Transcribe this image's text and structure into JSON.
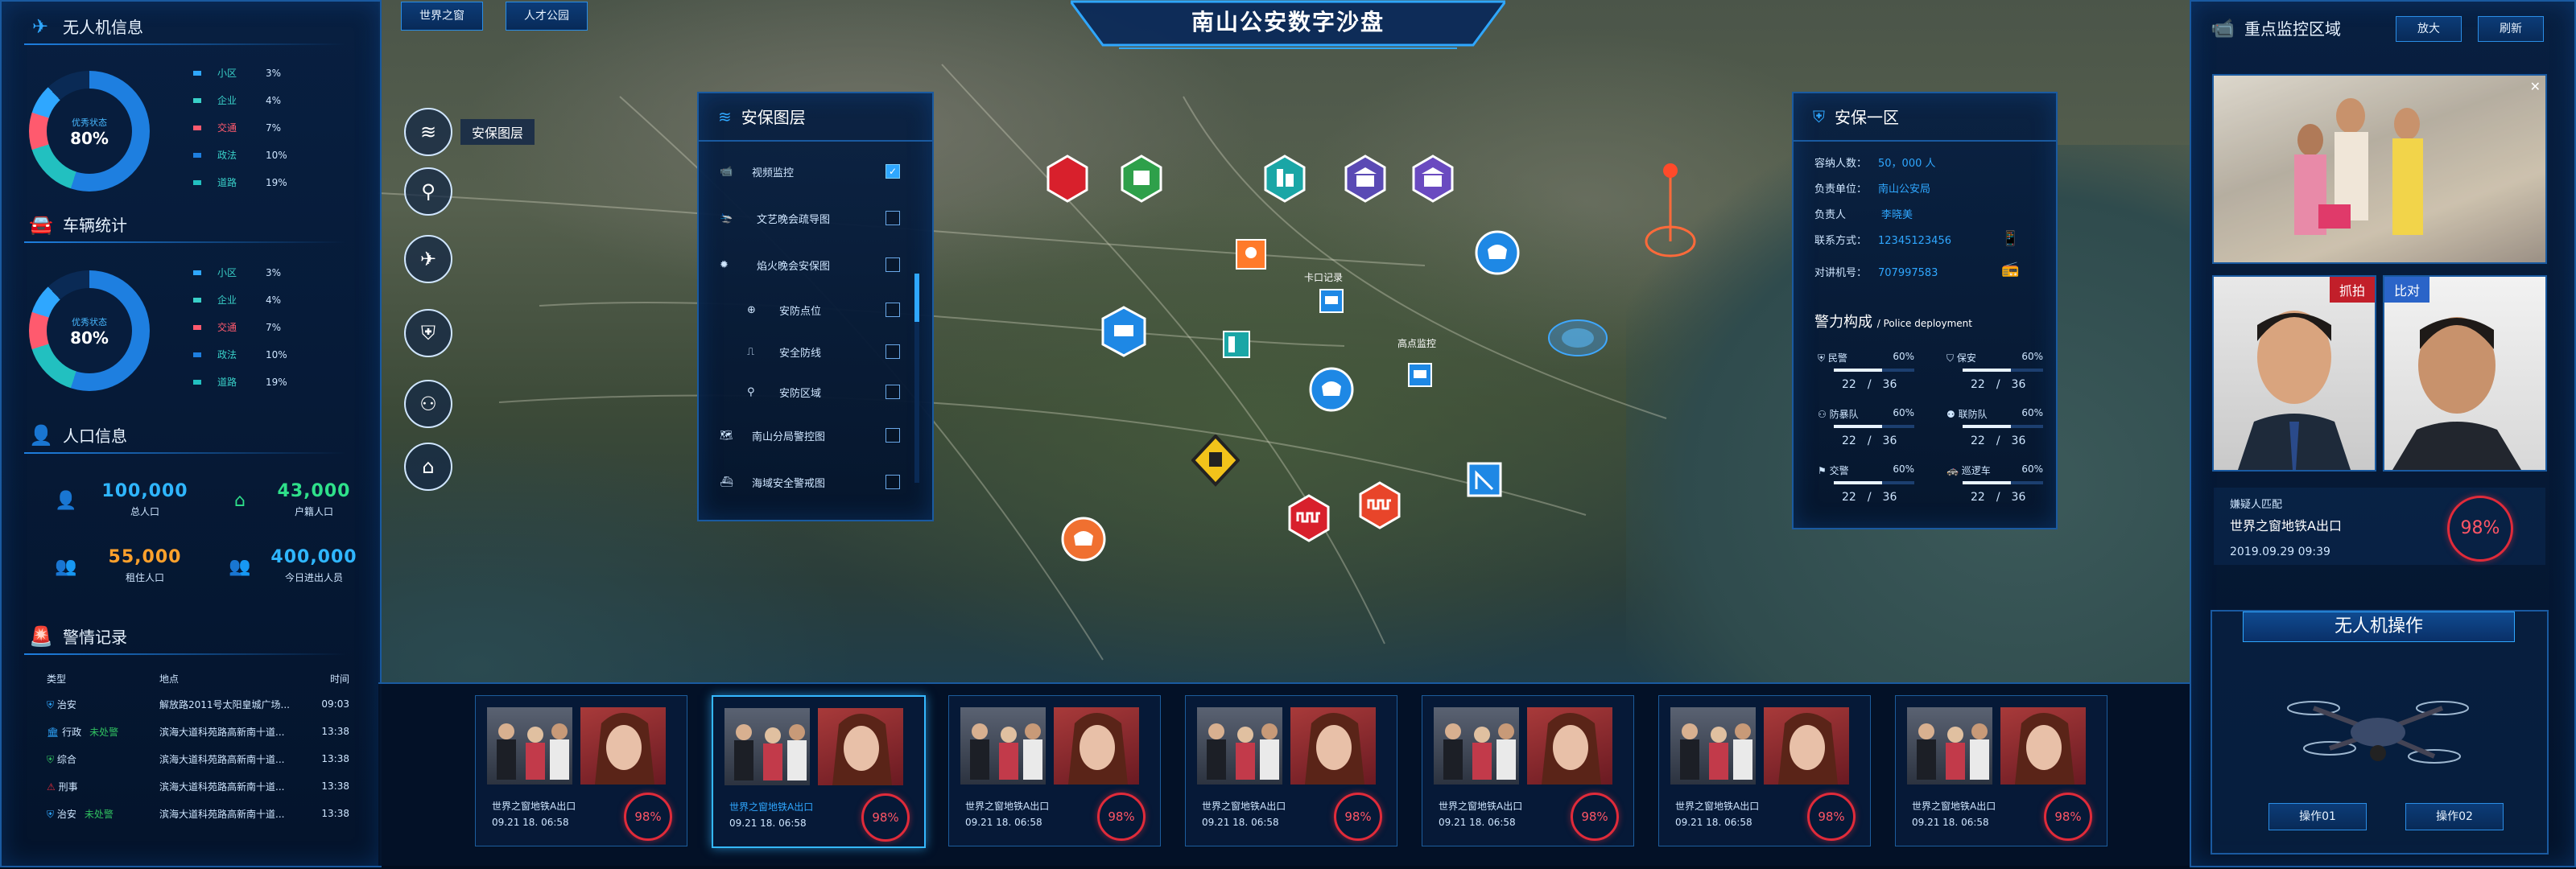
{
  "title": "南山公安数字沙盘",
  "top_tabs": [
    "世界之窗",
    "人才公园"
  ],
  "drone": {
    "title": "无人机信息",
    "status": "优秀状态",
    "percent": "80%",
    "legend": [
      {
        "label": "小区",
        "pct": "3%",
        "color": "#2fa7ff"
      },
      {
        "label": "企业",
        "pct": "4%",
        "color": "#39d0c8"
      },
      {
        "label": "交通",
        "pct": "7%",
        "color": "#ff5a6e"
      },
      {
        "label": "政法",
        "pct": "10%",
        "color": "#1e7fe0"
      },
      {
        "label": "道路",
        "pct": "19%",
        "color": "#22c0c0"
      }
    ]
  },
  "vehicle": {
    "title": "车辆统计",
    "status": "优秀状态",
    "percent": "80%",
    "legend": [
      {
        "label": "小区",
        "pct": "3%",
        "color": "#2fa7ff"
      },
      {
        "label": "企业",
        "pct": "4%",
        "color": "#39d0c8"
      },
      {
        "label": "交通",
        "pct": "7%",
        "color": "#ff5a6e"
      },
      {
        "label": "政法",
        "pct": "10%",
        "color": "#1e7fe0"
      },
      {
        "label": "道路",
        "pct": "19%",
        "color": "#22c0c0"
      }
    ]
  },
  "population": {
    "title": "人口信息",
    "items": [
      {
        "num": "100,000",
        "cap": "总人口",
        "color": "#2fb6ff"
      },
      {
        "num": "43,000",
        "cap": "户籍人口",
        "color": "#2fe08a"
      },
      {
        "num": "55,000",
        "cap": "租住人口",
        "color": "#ffa12c"
      },
      {
        "num": "400,000",
        "cap": "今日进出人员",
        "color": "#2fb6ff"
      }
    ]
  },
  "alarms": {
    "title": "警情记录",
    "headers": [
      "类型",
      "地点",
      "时间"
    ],
    "rows": [
      {
        "type": "治安",
        "status": "",
        "place": "解放路2011号太阳皇城广场...",
        "time": "09:03",
        "color": "#2fa7ff"
      },
      {
        "type": "行政",
        "status": "未处警",
        "place": "滨海大道科苑路高新南十道...",
        "time": "13:38",
        "color": "#2fa7ff"
      },
      {
        "type": "综合",
        "status": "",
        "place": "滨海大道科苑路高新南十道...",
        "time": "13:38",
        "color": "#30c060"
      },
      {
        "type": "刑事",
        "status": "",
        "place": "滨海大道科苑路高新南十道...",
        "time": "13:38",
        "color": "#e02b3a"
      },
      {
        "type": "治安",
        "status": "未处警",
        "place": "滨海大道科苑路高新南十道...",
        "time": "13:38",
        "color": "#2fa7ff"
      }
    ]
  },
  "map_tools": {
    "active_label": "安保图层"
  },
  "layers": {
    "title": "安保图层",
    "items": [
      {
        "label": "视频监控",
        "checked": true,
        "indent": false
      },
      {
        "label": "文艺晚会疏导图",
        "checked": false,
        "indent": false
      },
      {
        "label": "焰火晚会安保图",
        "checked": false,
        "indent": false
      },
      {
        "label": "安防点位",
        "checked": false,
        "indent": true
      },
      {
        "label": "安全防线",
        "checked": false,
        "indent": true
      },
      {
        "label": "安防区域",
        "checked": false,
        "indent": true
      },
      {
        "label": "南山分局警控图",
        "checked": false,
        "indent": false
      },
      {
        "label": "海域安全警戒图",
        "checked": false,
        "indent": false
      }
    ]
  },
  "security_zone": {
    "title": "安保一区",
    "fields": [
      {
        "k": "容纳人数：",
        "v": "50，000 人"
      },
      {
        "k": "负责单位：",
        "v": "南山公安局"
      },
      {
        "k": "负责人",
        "v": "李晓美"
      },
      {
        "k": "联系方式：",
        "v": "12345123456"
      },
      {
        "k": "对讲机号：",
        "v": "707997583"
      }
    ],
    "force_title": "警力构成",
    "force_sub": "Police deployment",
    "force": [
      {
        "label": "民警",
        "pct": "60%",
        "num": "22",
        "total": "36",
        "level": 0.6
      },
      {
        "label": "保安",
        "pct": "60%",
        "num": "22",
        "total": "36",
        "level": 0.6
      },
      {
        "label": "防暴队",
        "pct": "60%",
        "num": "22",
        "total": "36",
        "level": 0.6
      },
      {
        "label": "联防队",
        "pct": "60%",
        "num": "22",
        "total": "36",
        "level": 0.6
      },
      {
        "label": "交警",
        "pct": "60%",
        "num": "22",
        "total": "36",
        "level": 0.6
      },
      {
        "label": "巡逻车",
        "pct": "60%",
        "num": "22",
        "total": "36",
        "level": 0.6
      }
    ]
  },
  "map_labels": {
    "a": "卡口记录",
    "b": "高点监控"
  },
  "monitor": {
    "title": "重点监控区域",
    "btn_zoom": "放大",
    "btn_refresh": "刷新",
    "tag_capture": "抓拍",
    "tag_compare": "比对",
    "match_title": "嫌疑人匹配",
    "match_place": "世界之窗地铁A出口",
    "match_time": "2019.09.29  09:39",
    "match_pct": "98%"
  },
  "drone_op": {
    "title": "无人机操作",
    "btn1": "操作01",
    "btn2": "操作02"
  },
  "captures": [
    {
      "place": "世界之窗地铁A出口",
      "time": "09.21 18.  06:58",
      "pct": "98%",
      "selected": false
    },
    {
      "place": "世界之窗地铁A出口",
      "time": "09.21 18.  06:58",
      "pct": "98%",
      "selected": true
    },
    {
      "place": "世界之窗地铁A出口",
      "time": "09.21 18.  06:58",
      "pct": "98%",
      "selected": false
    },
    {
      "place": "世界之窗地铁A出口",
      "time": "09.21 18.  06:58",
      "pct": "98%",
      "selected": false
    },
    {
      "place": "世界之窗地铁A出口",
      "time": "09.21 18.  06:58",
      "pct": "98%",
      "selected": false
    },
    {
      "place": "世界之窗地铁A出口",
      "time": "09.21 18.  06:58",
      "pct": "98%",
      "selected": false
    },
    {
      "place": "世界之窗地铁A出口",
      "time": "09.21 18.  06:58",
      "pct": "98%",
      "selected": false
    }
  ]
}
